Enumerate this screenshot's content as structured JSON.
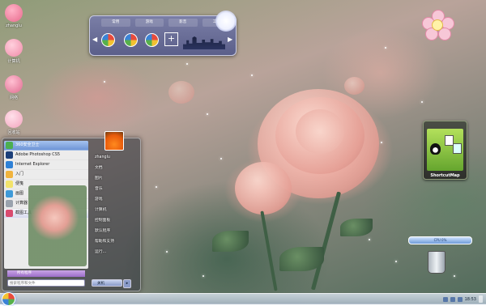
{
  "desktop_icons": [
    {
      "label": "zhanglu",
      "icon": "user-folder-icon",
      "color": "#e86a8d"
    },
    {
      "label": "计算机",
      "icon": "computer-icon",
      "color": "#f08aa8"
    },
    {
      "label": "网络",
      "icon": "network-icon",
      "color": "#e06b90"
    },
    {
      "label": "回收站",
      "icon": "recycle-bin-icon",
      "color": "#f3a4bd"
    }
  ],
  "skin_panel": {
    "tabs": [
      "常用",
      "游戏",
      "影音",
      "工作"
    ],
    "add_label": "+"
  },
  "gadget": {
    "label": "ShortcutMap"
  },
  "slider": {
    "label": "CPU 0%"
  },
  "start_menu": {
    "programs": [
      {
        "label": "360安全卫士",
        "color": "#4caf50"
      },
      {
        "label": "Adobe Photoshop CS5",
        "color": "#1c3f7a"
      },
      {
        "label": "Internet Explorer",
        "color": "#2f80d6"
      },
      {
        "label": "入门",
        "color": "#f1b33d"
      },
      {
        "label": "便笺",
        "color": "#f3e36b"
      },
      {
        "label": "画图",
        "color": "#3f9ad8"
      },
      {
        "label": "计算器",
        "color": "#9aa2ad"
      },
      {
        "label": "截图工具",
        "color": "#d94b6f"
      }
    ],
    "all_programs": "所有程序",
    "search_placeholder": "搜索程序和文件",
    "user_name": "zhanglu",
    "right_items": [
      "zhanglu",
      "文档",
      "图片",
      "音乐",
      "游戏",
      "计算机",
      "控制面板",
      "默认程序",
      "帮助和支持",
      "运行..."
    ],
    "shutdown_label": "关机"
  },
  "taskbar": {
    "clock": "18:53"
  }
}
